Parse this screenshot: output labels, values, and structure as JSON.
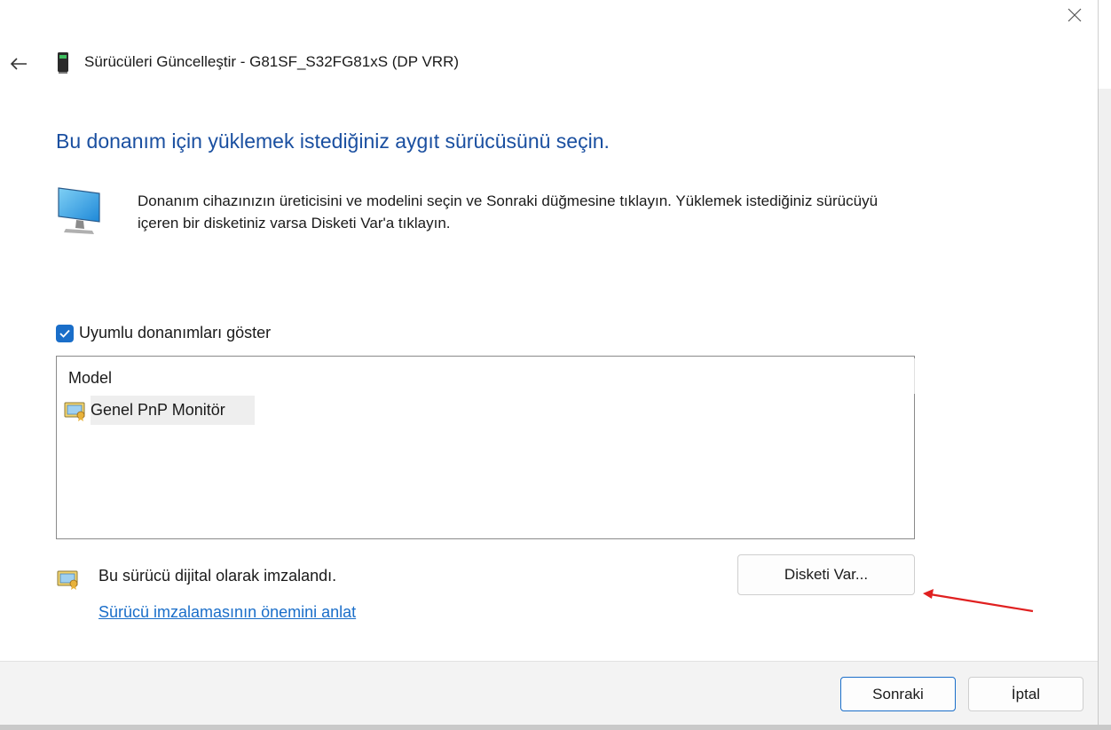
{
  "window": {
    "title": "Sürücüleri Güncelleştir - G81SF_S32FG81xS (DP VRR)",
    "close_icon": "close-icon",
    "back_icon": "back-arrow-icon"
  },
  "main": {
    "heading": "Bu donanım için yüklemek istediğiniz aygıt sürücüsünü seçin.",
    "description": "Donanım cihazınızın üreticisini ve modelini seçin ve Sonraki düğmesine tıklayın. Yüklemek istediğiniz sürücüyü içeren bir disketiniz varsa Disketi Var'a tıklayın.",
    "monitor_icon": "monitor-icon"
  },
  "compatible": {
    "label": "Uyumlu donanımları göster",
    "checked": true
  },
  "model_list": {
    "header": "Model",
    "items": [
      {
        "label": "Genel PnP Monitör",
        "icon": "certificate-icon",
        "selected": true
      }
    ]
  },
  "signature": {
    "text": "Bu sürücü dijital olarak imzalandı.",
    "link": "Sürücü imzalamasının önemini anlat",
    "icon": "certificate-icon"
  },
  "buttons": {
    "have_disk": "Disketi Var...",
    "next": "Sonraki",
    "cancel": "İptal"
  },
  "annotation": {
    "arrow_color": "#e02020"
  }
}
